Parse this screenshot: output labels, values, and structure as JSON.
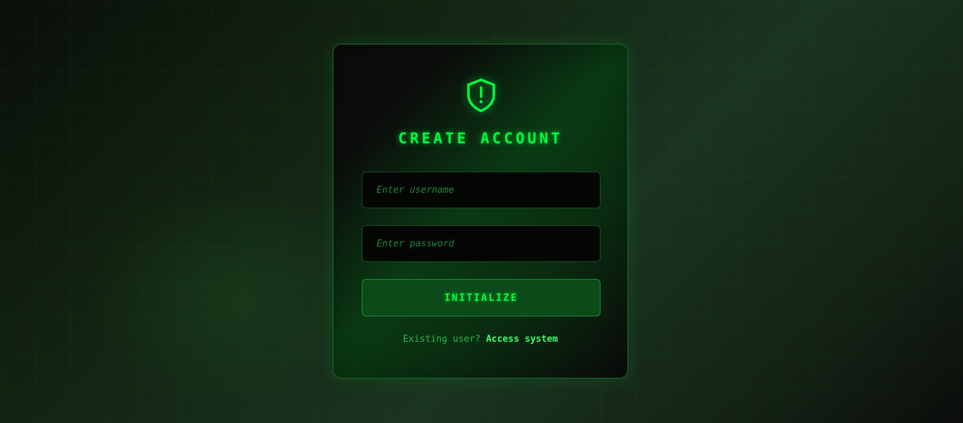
{
  "form": {
    "title": "CREATE ACCOUNT",
    "username_placeholder": "Enter username",
    "password_placeholder": "Enter password",
    "submit_label": "INITIALIZE",
    "footer_prompt": "Existing user?",
    "footer_link": "Access system"
  },
  "icons": {
    "header": "shield-alert-icon"
  },
  "colors": {
    "accent": "#00ff41",
    "card_border": "#1b6b2a",
    "button_bg": "#0b4a19",
    "input_bg": "#040604"
  }
}
